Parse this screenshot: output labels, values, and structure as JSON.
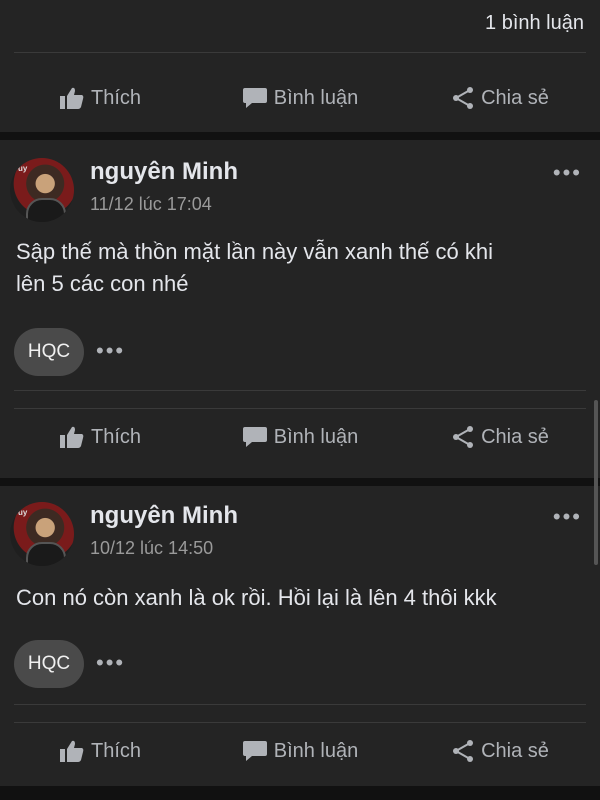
{
  "top": {
    "comment_count": "1 bình luận"
  },
  "actions": {
    "like": "Thích",
    "comment": "Bình luận",
    "share": "Chia sẻ"
  },
  "posts": [
    {
      "user": "nguyên Minh",
      "time": "11/12 lúc 17:04",
      "text_line1": "Sập thế mà thồn mặt lần này vẫn xanh thế có khi",
      "text_line2": "lên 5 các con nhé",
      "chip": "HQC"
    },
    {
      "user": "nguyên Minh",
      "time": "10/12 lúc 14:50",
      "text_line1": "Con nó còn xanh là ok rồi. Hồi lại là lên 4 thôi kkk",
      "chip": "HQC"
    }
  ],
  "icons": {
    "like": "thumbs-up-icon",
    "comment": "speech-bubble-icon",
    "share": "share-icon",
    "more": "ellipsis-icon"
  },
  "colors": {
    "background": "#111111",
    "card": "#242424",
    "text": "#e4e6eb",
    "muted": "#b0b3b8",
    "chip": "#4a4a4a"
  }
}
